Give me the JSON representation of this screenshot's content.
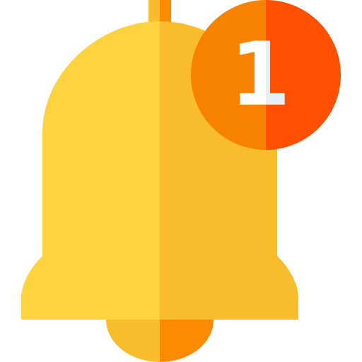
{
  "notification_icon": {
    "badge_count": "1",
    "colors": {
      "bell_left": "#FCD23F",
      "bell_right": "#F9BC2C",
      "clapper_left": "#F9BC2C",
      "clapper_right": "#FF8C00",
      "hanger_left": "#F9BC2C",
      "hanger_right": "#FF8C00",
      "badge_left": "#F78200",
      "badge_right": "#FF5000",
      "badge_text_left": "#FFFFFF",
      "badge_text_right": "#E6EEF6"
    },
    "icons": {
      "bell": "bell-icon",
      "badge": "notification-badge-icon"
    }
  }
}
